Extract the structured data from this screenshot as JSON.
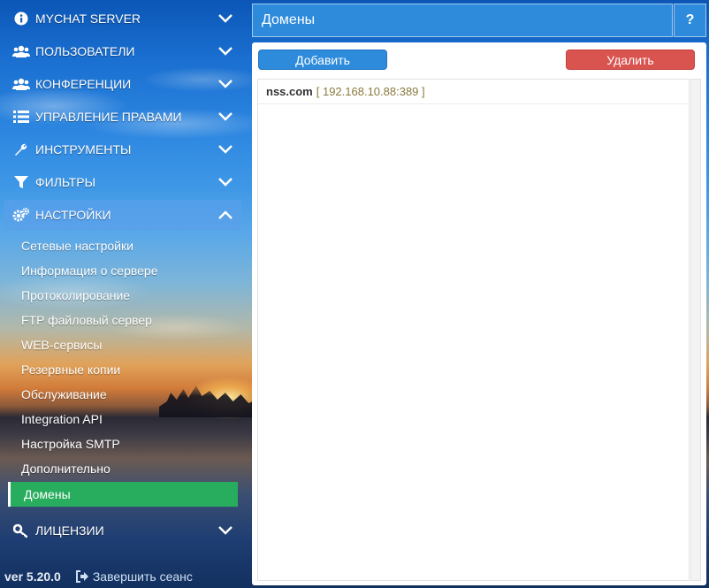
{
  "sidebar": {
    "menu": [
      {
        "label": "MYCHAT SERVER",
        "icon": "info-icon"
      },
      {
        "label": "ПОЛЬЗОВАТЕЛИ",
        "icon": "users-icon"
      },
      {
        "label": "КОНФЕРЕНЦИИ",
        "icon": "users-icon"
      },
      {
        "label": "УПРАВЛЕНИЕ ПРАВАМИ",
        "icon": "list-icon"
      },
      {
        "label": "ИНСТРУМЕНТЫ",
        "icon": "wrench-icon"
      },
      {
        "label": "ФИЛЬТРЫ",
        "icon": "filter-icon"
      },
      {
        "label": "НАСТРОЙКИ",
        "icon": "gears-icon"
      },
      {
        "label": "ЛИЦЕНЗИИ",
        "icon": "key-icon"
      }
    ],
    "settings_submenu": [
      "Сетевые настройки",
      "Информация о сервере",
      "Протоколирование",
      "FTP файловый сервер",
      "WEB-сервисы",
      "Резервные копии",
      "Обслуживание",
      "Integration API",
      "Настройка SMTP",
      "Дополнительно",
      "Домены"
    ],
    "version": "ver 5.20.0",
    "logout": "Завершить сеанс"
  },
  "main": {
    "title": "Домены",
    "help_label": "?",
    "add_button": "Добавить",
    "delete_button": "Удалить",
    "domains": [
      {
        "name": "nss.com",
        "server": "[ 192.168.10.88:389 ]"
      }
    ]
  },
  "colors": {
    "accent": "#2e8bdc",
    "selected": "#27ad5d",
    "danger": "#d9534f"
  }
}
